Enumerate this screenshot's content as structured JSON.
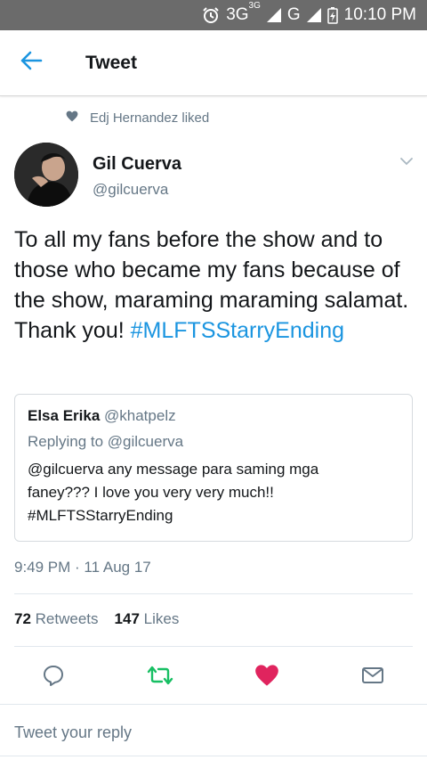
{
  "status_bar": {
    "network_3g": "3G",
    "network_3g_sup": "3G",
    "network_g": "G",
    "time": "10:10 PM",
    "icons": [
      "alarm-icon",
      "signal-icon",
      "battery-charging-icon"
    ]
  },
  "app_bar": {
    "title": "Tweet",
    "back_icon": "arrow-left-icon"
  },
  "social_context": {
    "text": "Edj Hernandez liked",
    "icon": "heart-icon"
  },
  "author": {
    "name": "Gil Cuerva",
    "handle": "@gilcuerva"
  },
  "tweet": {
    "text": "To all my fans before the show and to those who became my fans because of the show, maraming maraming salamat. Thank you! ",
    "hashtag": "#MLFTSStarryEnding"
  },
  "quoted_tweet": {
    "name": "Elsa Erika",
    "handle": "@khatpelz",
    "replying_to": "Replying to @gilcuerva",
    "body_line1": "@gilcuerva any message para saming mga",
    "body_line2": "faney??? I love you very very much!!",
    "body_line3": "#MLFTSStarryEnding"
  },
  "timestamp": "9:49 PM · 11 Aug 17",
  "stats": {
    "retweets_count": "72",
    "retweets_label": "Retweets",
    "likes_count": "147",
    "likes_label": "Likes"
  },
  "actions": {
    "reply_icon": "reply-icon",
    "retweet_icon": "retweet-icon",
    "like_icon": "heart-icon",
    "dm_icon": "envelope-icon"
  },
  "colors": {
    "accent": "#1b95e0",
    "retweet_green": "#17bf63",
    "like_red": "#e0245e",
    "secondary_text": "#657786",
    "status_bar": "#6b6b6b"
  },
  "reply_placeholder": "Tweet your reply"
}
